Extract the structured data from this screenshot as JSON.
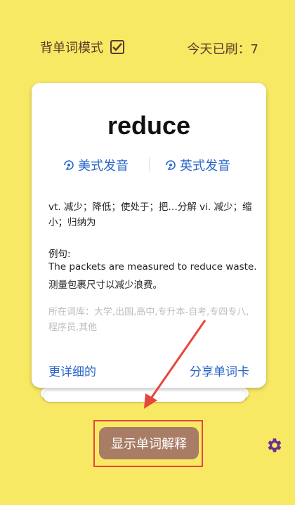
{
  "header": {
    "mode_label": "背单词模式",
    "mode_checked": true,
    "today_count": "今天已刷：7"
  },
  "card": {
    "word": "reduce",
    "pron_us": "美式发音",
    "pron_uk": "英式发音",
    "definition": "vt. 减少；降低；使处于；把…分解 vi. 减少；缩小；归纳为",
    "example_label": "例句:",
    "example_en": "The packets are measured to reduce waste.",
    "example_zh": "测量包裹尺寸以减少浪费。",
    "library": "所在词库：大学,出国,高中,专升本-自考,专四专八,程序员,其他",
    "more_link": "更详细的",
    "share_link": "分享单词卡"
  },
  "actions": {
    "show_button": "显示单词解释"
  },
  "colors": {
    "background": "#f8e965",
    "accent_blue": "#2a66c9",
    "button": "#a97c66",
    "annotation_red": "#e8453c",
    "gear": "#6b2f8f"
  },
  "icons": {
    "checkbox": "checkbox-checked-icon",
    "speaker": "speaker-icon",
    "settings": "gear-icon"
  }
}
